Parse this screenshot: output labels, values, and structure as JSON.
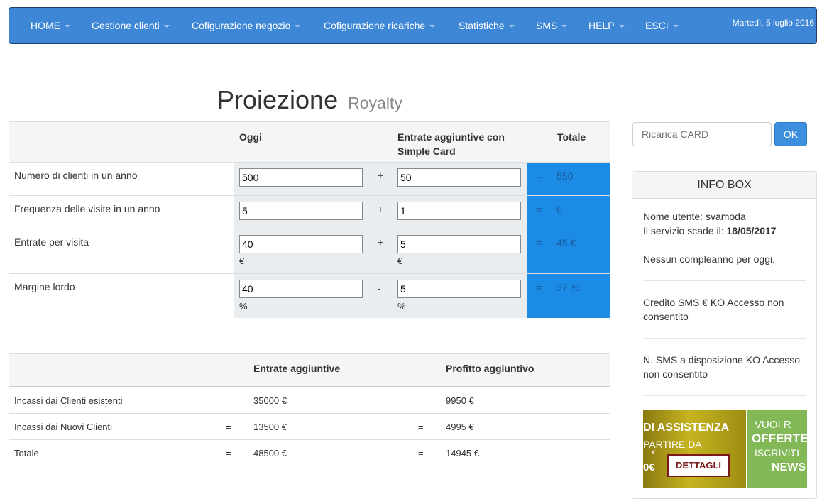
{
  "nav": {
    "items": [
      {
        "label": "HOME"
      },
      {
        "label": "Gestione clienti"
      },
      {
        "label": "Cofigurazione negozio"
      },
      {
        "label": "Cofigurazione ricariche"
      },
      {
        "label": "Statistiche"
      },
      {
        "label": "SMS"
      },
      {
        "label": "HELP"
      },
      {
        "label": "ESCI"
      }
    ],
    "date": "Martedì, 5 luglio 2016"
  },
  "page": {
    "title": "Proiezione",
    "subtitle": "Royalty"
  },
  "projection": {
    "headers": {
      "today": "Oggi",
      "extra_line1": "Entrate aggiuntive con",
      "extra_line2": "Simple Card",
      "total": "Totale"
    },
    "rows": [
      {
        "label": "Numero di clienti in un anno",
        "today": "500",
        "op": "+",
        "extra": "50",
        "eq": "=",
        "total": "550",
        "unit": ""
      },
      {
        "label": "Frequenza delle visite in un anno",
        "today": "5",
        "op": "+",
        "extra": "1",
        "eq": "=",
        "total": "6",
        "unit": ""
      },
      {
        "label": "Entrate per visita",
        "today": "40",
        "op": "+",
        "extra": "5",
        "eq": "=",
        "total": "45 €",
        "unit": "€"
      },
      {
        "label": "Margine lordo",
        "today": "40",
        "op": "-",
        "extra": "5",
        "eq": "=",
        "total": "37 %",
        "unit": "%"
      }
    ]
  },
  "summary": {
    "headers": {
      "revenue": "Entrate aggiuntive",
      "profit": "Profitto aggiuntivo"
    },
    "rows": [
      {
        "label": "Incassi dai Clienti esistenti",
        "eq1": "=",
        "revenue": "35000 €",
        "eq2": "=",
        "profit": "9950 €"
      },
      {
        "label": "Incassi dai Nuovi Clienti",
        "eq1": "=",
        "revenue": "13500 €",
        "eq2": "=",
        "profit": "4995 €"
      },
      {
        "label": "Totale",
        "eq1": "=",
        "revenue": "48500 €",
        "eq2": "=",
        "profit": "14945 €"
      }
    ]
  },
  "sidebar": {
    "search_placeholder": "Ricarica CARD",
    "ok_label": "OK",
    "infobox": {
      "title": "INFO BOX",
      "user_line": "Nome utente: svamoda",
      "expiry_label": "Il servizio scade il:",
      "expiry_date": "18/05/2017",
      "birthday": "Nessun compleanno per oggi.",
      "sms_credit": "Credito SMS € KO Accesso non consentito",
      "sms_available": "N. SMS a disposizione KO Accesso non consentito"
    },
    "banner1": {
      "title": "DI ASSISTENZA",
      "subtitle": "PARTIRE DA",
      "price": "0€",
      "button": "DETTAGLI",
      "arrow": "‹"
    },
    "banner2": {
      "line1": "VUOI R",
      "line2": "OFFERTE",
      "line3": "ISCRIVITI",
      "line4": "NEWS",
      "arrow": "›"
    }
  }
}
